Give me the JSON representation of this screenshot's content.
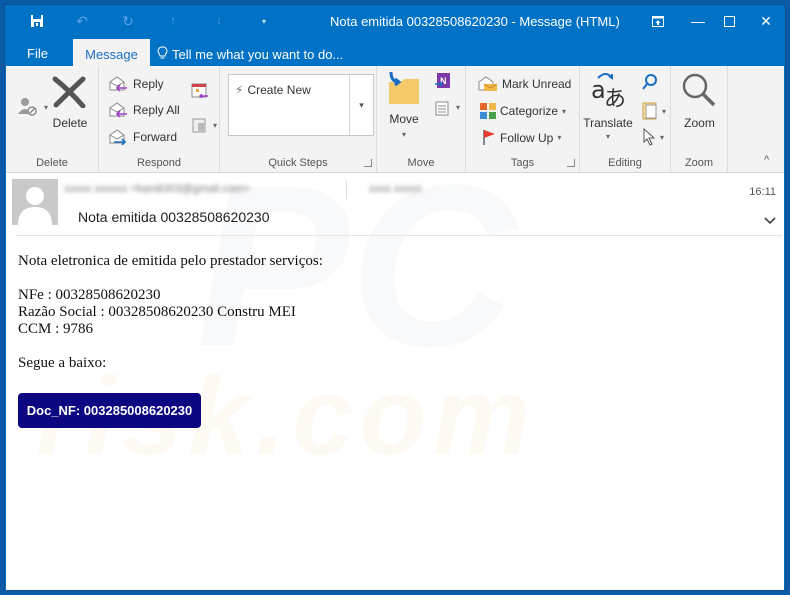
{
  "window": {
    "title": "Nota emitida 00328508620230 - Message (HTML)",
    "controls": [
      "ribbon-display-options",
      "minimize",
      "maximize",
      "close"
    ]
  },
  "quick_access": {
    "items": [
      "save",
      "undo",
      "redo",
      "previous-item",
      "next-item",
      "customize"
    ]
  },
  "tabs": {
    "file": "File",
    "message": "Message",
    "tell_me": "Tell me what you want to do..."
  },
  "ribbon": {
    "groups": {
      "delete": {
        "label": "Delete",
        "delete_button": "Delete"
      },
      "respond": {
        "label": "Respond",
        "reply": "Reply",
        "reply_all": "Reply All",
        "forward": "Forward"
      },
      "quick_steps": {
        "label": "Quick Steps",
        "create_new": "Create New"
      },
      "move": {
        "label": "Move",
        "move_button": "Move"
      },
      "tags": {
        "label": "Tags",
        "mark_unread": "Mark Unread",
        "categorize": "Categorize",
        "follow_up": "Follow Up"
      },
      "editing": {
        "label": "Editing",
        "translate": "Translate"
      },
      "zoom": {
        "label": "Zoom",
        "zoom_button": "Zoom"
      }
    }
  },
  "message": {
    "sender": "xxxxx xxxxxx <kandi303@gmail.com>",
    "recipient": "xxxx xxxxx",
    "subject": "Nota emitida 00328508620230",
    "time": "16:11",
    "body": {
      "line1": "Nota eletronica de emitida pelo prestador serviços:",
      "nfe": "NFe : 00328508620230",
      "razao": "Razão Social : 00328508620230 Constru MEI",
      "ccm": "CCM : 9786",
      "segue": "Segue a baixo:"
    },
    "attachment_button": "Doc_NF: 003285008620230",
    "attachment_button_color": "#0c0680"
  },
  "watermark": "risk.com"
}
